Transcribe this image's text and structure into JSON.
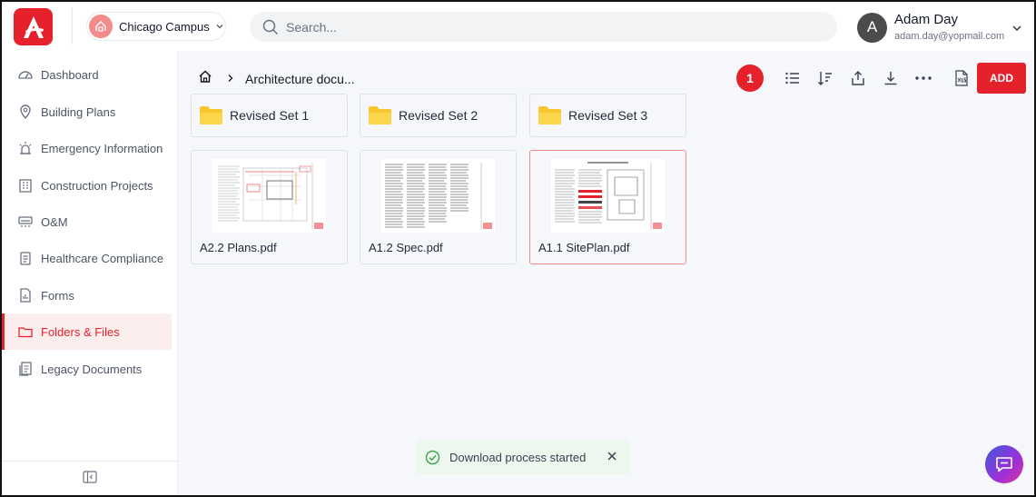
{
  "header": {
    "campus_label": "Chicago Campus",
    "search_placeholder": "Search...",
    "user_initial": "A",
    "user_name": "Adam Day",
    "user_email": "adam.day@yopmail.com",
    "brand_color": "#e5222b"
  },
  "sidebar": {
    "items": [
      {
        "label": "Dashboard",
        "icon": "gauge-icon"
      },
      {
        "label": "Building Plans",
        "icon": "map-pin-icon"
      },
      {
        "label": "Emergency Information",
        "icon": "alarm-light-icon"
      },
      {
        "label": "Construction Projects",
        "icon": "building-icon"
      },
      {
        "label": "O&M",
        "icon": "hvac-icon"
      },
      {
        "label": "Healthcare Compliance",
        "icon": "clipboard-icon"
      },
      {
        "label": "Forms",
        "icon": "form-icon"
      },
      {
        "label": "Folders & Files",
        "icon": "folder-icon",
        "active": true
      },
      {
        "label": "Legacy Documents",
        "icon": "documents-icon"
      }
    ]
  },
  "main": {
    "breadcrumb": "Architecture docu...",
    "selected_count": "1",
    "add_label": "ADD",
    "folders": [
      {
        "label": "Revised Set 1"
      },
      {
        "label": "Revised Set 2"
      },
      {
        "label": "Revised Set 3"
      }
    ],
    "files": [
      {
        "label": "A2.2 Plans.pdf"
      },
      {
        "label": "A1.2 Spec.pdf"
      },
      {
        "label": "A1.1 SitePlan.pdf",
        "selected": true
      }
    ],
    "toast": "Download process started"
  }
}
